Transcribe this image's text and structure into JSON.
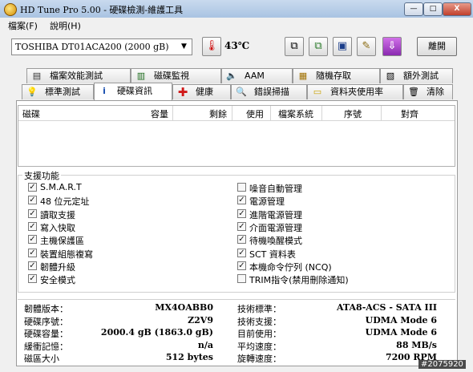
{
  "window": {
    "title": "HD Tune Pro  5.00 - 硬碟檢測-維護工具",
    "minimize": "—",
    "maximize": "□",
    "close": "X"
  },
  "menu": {
    "file": "檔案(F)",
    "help": "說明(H)"
  },
  "toolbar": {
    "drive": "TOSHIBA DT01ACA200 (2000 gB)",
    "temperature": "43℃",
    "exit": "離開"
  },
  "tabs_top": [
    {
      "label": "檔案效能測試",
      "icon": "file-benchmark-icon"
    },
    {
      "label": "磁碟監視",
      "icon": "disk-monitor-icon"
    },
    {
      "label": "AAM",
      "icon": "speaker-icon"
    },
    {
      "label": "隨機存取",
      "icon": "random-access-icon"
    },
    {
      "label": "額外測試",
      "icon": "extra-tests-icon"
    }
  ],
  "tabs_bottom": [
    {
      "label": "標準測試",
      "icon": "benchmark-icon"
    },
    {
      "label": "硬碟資訊",
      "icon": "info-icon"
    },
    {
      "label": "健康",
      "icon": "health-cross-icon"
    },
    {
      "label": "錯誤掃描",
      "icon": "error-scan-icon"
    },
    {
      "label": "資料夾使用率",
      "icon": "folder-icon"
    },
    {
      "label": "清除",
      "icon": "trash-icon"
    }
  ],
  "partitions_table": {
    "columns": [
      "磁碟",
      "容量",
      "剩餘",
      "使用",
      "檔案系統",
      "序號",
      "對齊"
    ]
  },
  "features": {
    "title": "支援功能",
    "left": [
      {
        "label": "S.M.A.R.T",
        "checked": true
      },
      {
        "label": "48 位元定址",
        "checked": true
      },
      {
        "label": "讀取支援",
        "checked": true
      },
      {
        "label": "寫入快取",
        "checked": true
      },
      {
        "label": "主機保護區",
        "checked": true
      },
      {
        "label": "裝置組態複寫",
        "checked": true
      },
      {
        "label": "韌體升級",
        "checked": true
      },
      {
        "label": "安全模式",
        "checked": true
      }
    ],
    "right": [
      {
        "label": "噪音自動管理",
        "checked": false
      },
      {
        "label": "電源管理",
        "checked": true
      },
      {
        "label": "進階電源管理",
        "checked": true
      },
      {
        "label": "介面電源管理",
        "checked": true
      },
      {
        "label": "待機喚醒模式",
        "checked": true
      },
      {
        "label": "SCT 資料表",
        "checked": true
      },
      {
        "label": "本機命令佇列 (NCQ)",
        "checked": true
      },
      {
        "label": "TRIM指令(禁用刪除通知)",
        "checked": false
      }
    ]
  },
  "info": {
    "left": [
      {
        "label": "韌體版本：",
        "value": "MX4OABB0"
      },
      {
        "label": "硬碟序號：",
        "value": "Z2V9"
      },
      {
        "label": "硬碟容量：",
        "value": "2000.4 gB (1863.0 gB)"
      },
      {
        "label": "緩衝記憶：",
        "value": "n/a"
      },
      {
        "label": "磁區大小",
        "value": "512 bytes"
      }
    ],
    "right": [
      {
        "label": "技術標準：",
        "value": "ATA8-ACS - SATA III"
      },
      {
        "label": "技術支援：",
        "value": "UDMA Mode 6"
      },
      {
        "label": "目前使用：",
        "value": "UDMA Mode 6"
      },
      {
        "label": "平均速度：",
        "value": "88 MB/s"
      },
      {
        "label": "旋轉速度：",
        "value": "7200 RPM"
      }
    ]
  },
  "watermark": "#2075920"
}
